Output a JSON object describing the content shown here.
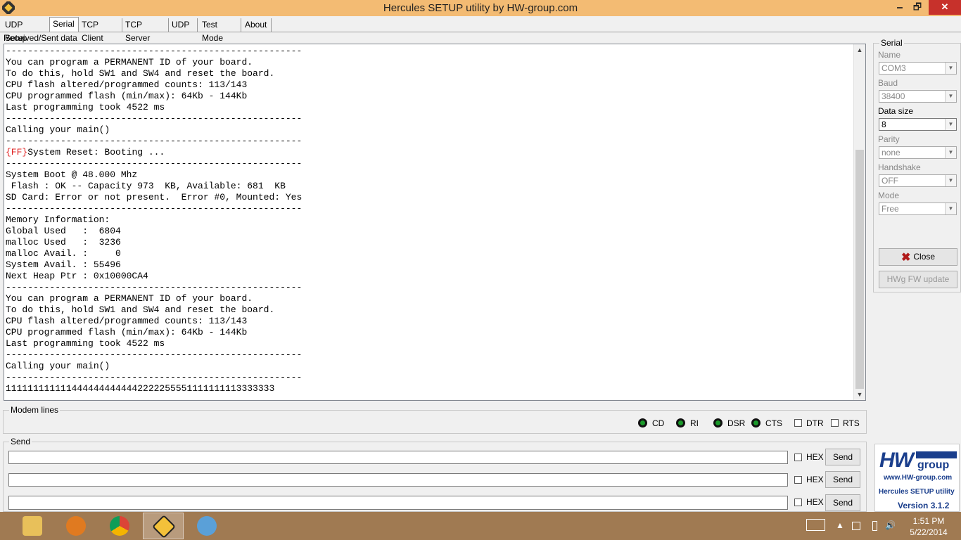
{
  "window": {
    "title": "Hercules SETUP utility by HW-group.com",
    "minimize_label": "🗕",
    "restore_label": "🗗",
    "close_label": "✕"
  },
  "tabs": [
    {
      "label": "UDP Setup"
    },
    {
      "label": "Serial",
      "active": true
    },
    {
      "label": "TCP Client"
    },
    {
      "label": "TCP Server"
    },
    {
      "label": "UDP"
    },
    {
      "label": "Test Mode"
    },
    {
      "label": "About"
    }
  ],
  "received": {
    "label": "Received/Sent data",
    "lines_before": "------------------------------------------------------\nYou can program a PERMANENT ID of your board.\nTo do this, hold SW1 and SW4 and reset the board.\nCPU flash altered/programmed counts: 113/143\nCPU programmed flash (min/max): 64Kb - 144Kb\nLast programming took 4522 ms\n------------------------------------------------------\nCalling your main()\n------------------------------------------------------",
    "ff_tag": "{FF}",
    "reset_line": "System Reset: Booting ...",
    "lines_after": "------------------------------------------------------\nSystem Boot @ 48.000 Mhz\n Flash : OK -- Capacity 973  KB, Available: 681  KB\nSD Card: Error or not present.  Error #0, Mounted: Yes\n------------------------------------------------------\nMemory Information:\nGlobal Used   :  6804\nmalloc Used   :  3236\nmalloc Avail. :     0\nSystem Avail. : 55496\nNext Heap Ptr : 0x10000CA4\n------------------------------------------------------\nYou can program a PERMANENT ID of your board.\nTo do this, hold SW1 and SW4 and reset the board.\nCPU flash altered/programmed counts: 113/143\nCPU programmed flash (min/max): 64Kb - 144Kb\nLast programming took 4522 ms\n------------------------------------------------------\nCalling your main()\n------------------------------------------------------\n1111111111114444444444442222255551111111113333333"
  },
  "serial": {
    "group_label": "Serial",
    "name_label": "Name",
    "name_value": "COM3",
    "baud_label": "Baud",
    "baud_value": "38400",
    "datasize_label": "Data size",
    "datasize_value": "8",
    "parity_label": "Parity",
    "parity_value": "none",
    "handshake_label": "Handshake",
    "handshake_value": "OFF",
    "mode_label": "Mode",
    "mode_value": "Free",
    "close_label": "Close",
    "fw_update_label": "HWg FW update"
  },
  "modem": {
    "group_label": "Modem lines",
    "leds": [
      "CD",
      "RI",
      "DSR",
      "CTS"
    ],
    "dtr_label": "DTR",
    "rts_label": "RTS"
  },
  "send": {
    "group_label": "Send",
    "hex_label": "HEX",
    "send_label": "Send"
  },
  "logo": {
    "hw": "HW",
    "group": "group",
    "url": "www.HW-group.com",
    "product": "Hercules SETUP utility",
    "version": "Version  3.1.2"
  },
  "taskbar": {
    "time": "1:51 PM",
    "date": "5/22/2014"
  }
}
